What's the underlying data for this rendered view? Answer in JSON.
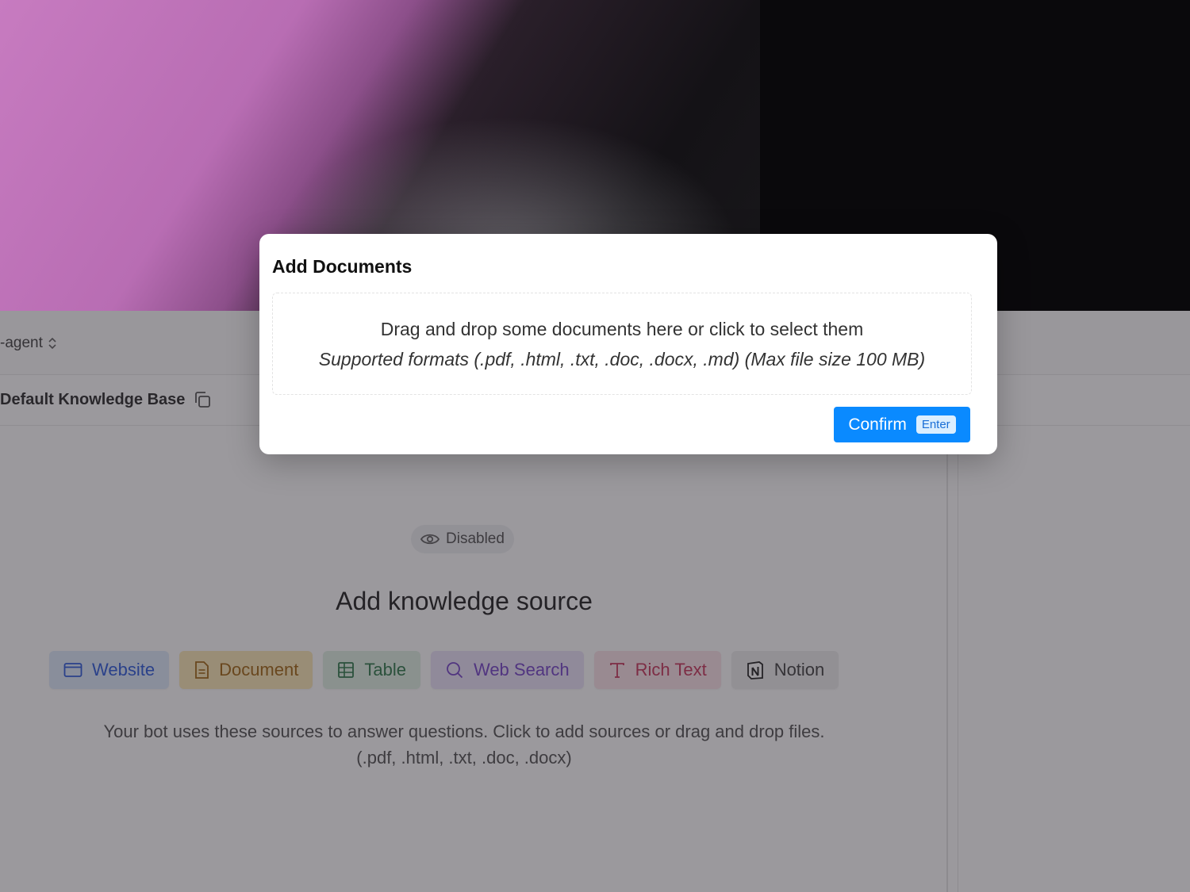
{
  "app": {
    "agent_selector": "-agent",
    "knowledge_base_title": "Default Knowledge Base",
    "status_badge": "Disabled",
    "knowledge_source": {
      "title": "Add knowledge source",
      "buttons": [
        {
          "label": "Website",
          "icon": "browser-window-icon",
          "color": "#1d4ed8"
        },
        {
          "label": "Document",
          "icon": "document-icon",
          "color": "#9a5a00"
        },
        {
          "label": "Table",
          "icon": "table-grid-icon",
          "color": "#1f6e3d"
        },
        {
          "label": "Web Search",
          "icon": "search-icon",
          "color": "#6a36c4"
        },
        {
          "label": "Rich Text",
          "icon": "text-t-icon",
          "color": "#c2264e"
        },
        {
          "label": "Notion",
          "icon": "notion-logo-icon",
          "color": "#333333"
        }
      ],
      "help_text": "Your bot uses these sources to answer questions. Click to add sources or drag and drop files. (.pdf, .html, .txt, .doc, .docx)"
    }
  },
  "modal": {
    "title": "Add Documents",
    "dropzone": {
      "main_text": "Drag and drop some documents here or click to select them",
      "formats_text": "Supported formats (.pdf, .html, .txt, .doc, .docx, .md) (Max file size 100 MB)"
    },
    "confirm_label": "Confirm",
    "confirm_shortcut": "Enter",
    "accent_color": "#0a8aff"
  }
}
